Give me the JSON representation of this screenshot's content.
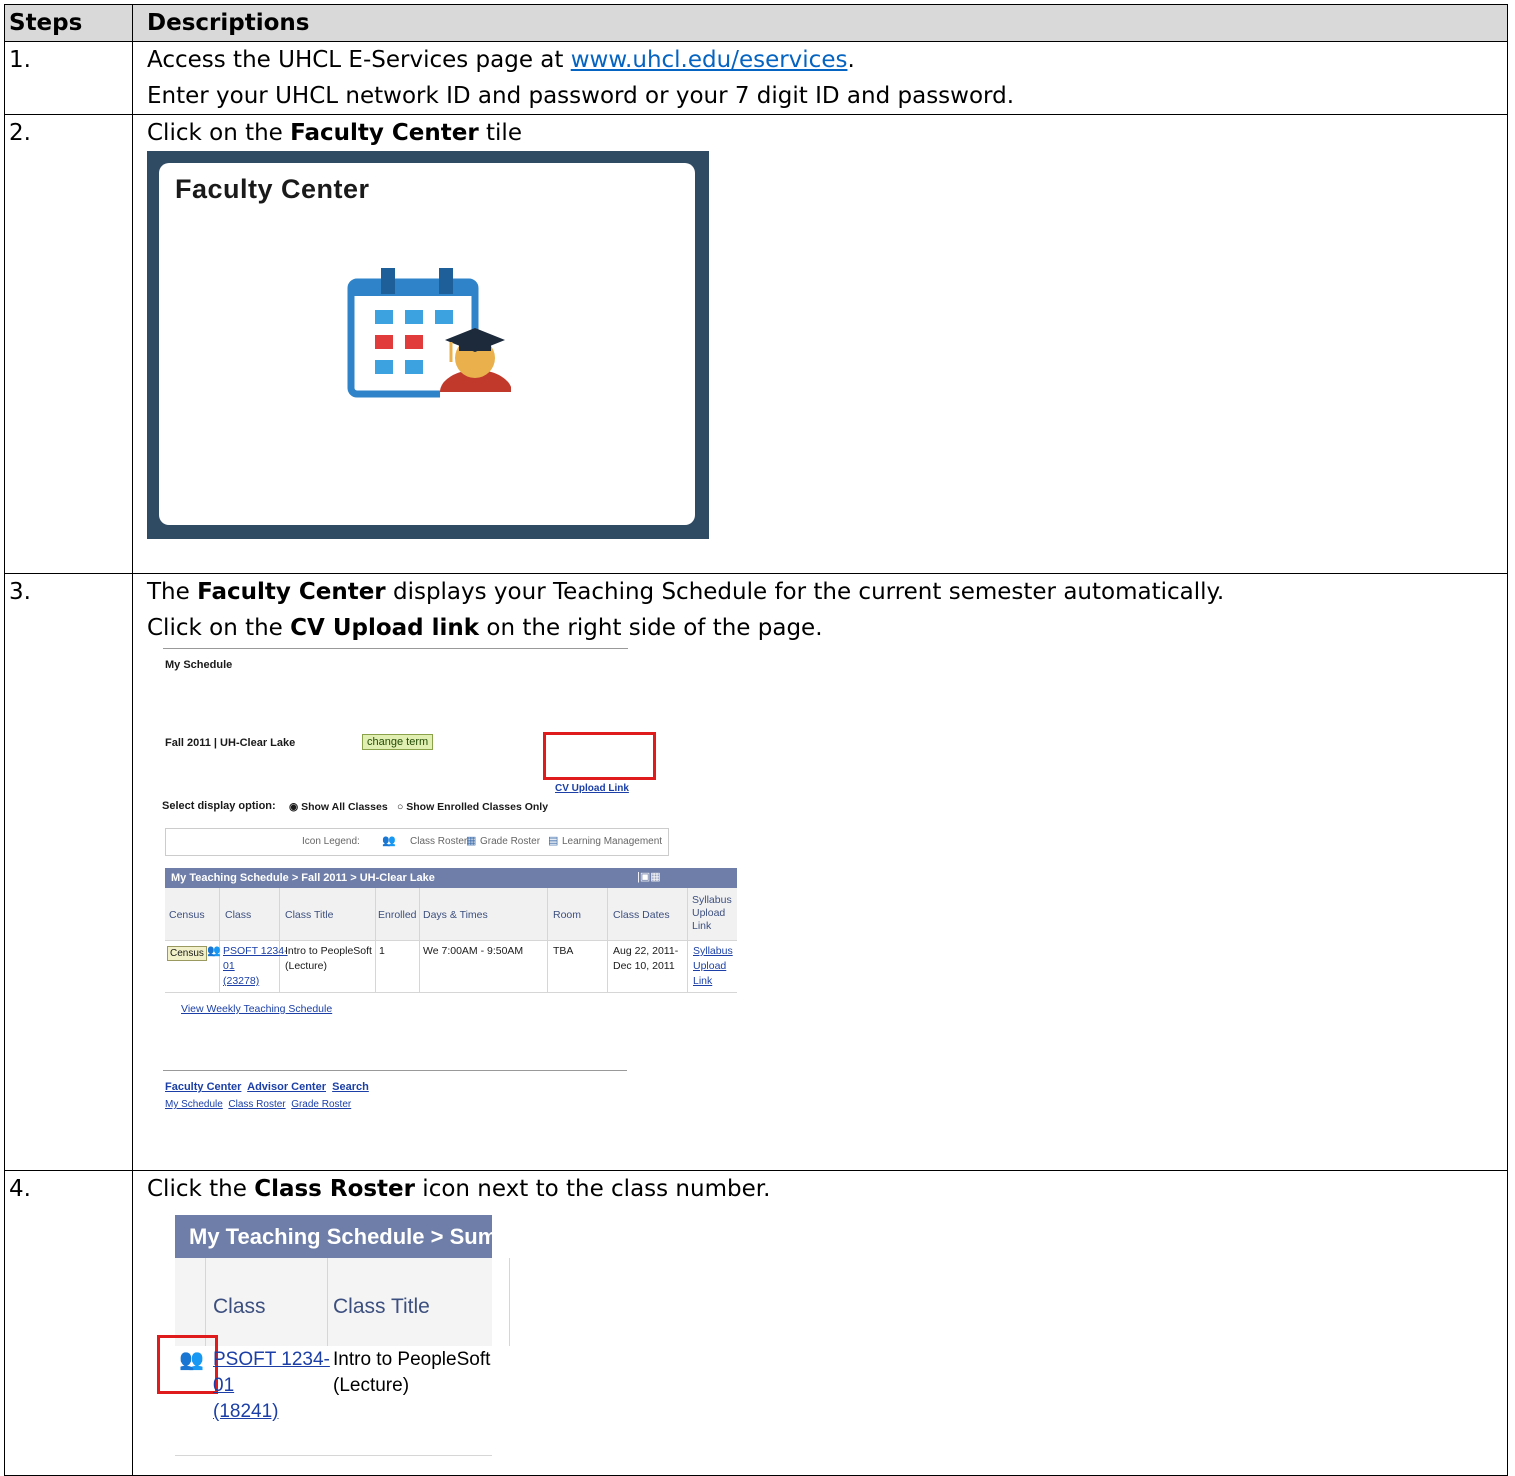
{
  "table": {
    "header_steps": "Steps",
    "header_desc": "Descriptions"
  },
  "step1": {
    "num": "1.",
    "line1_pre": "Access the UHCL E-Services page at ",
    "line1_link": "www.uhcl.edu/eservices",
    "line1_post": ".",
    "line2": "Enter your UHCL network ID and password or your 7 digit ID and password."
  },
  "step2": {
    "num": "2.",
    "pre": "Click on the ",
    "bold": "Faculty Center",
    "post": " tile",
    "tile_title": "Faculty Center"
  },
  "step3": {
    "num": "3.",
    "line1_pre": "The ",
    "line1_bold": "Faculty Center",
    "line1_post": " displays your Teaching Schedule for the current semester automatically.",
    "line2_pre": "Click on the ",
    "line2_bold": "CV Upload link",
    "line2_post": " on the right side of the page.",
    "shot": {
      "my_schedule": "My Schedule",
      "term": "Fall 2011 | UH-Clear Lake",
      "change_term": "change term",
      "cv_upload": "CV Upload Link",
      "select_display": "Select display option:",
      "opt_all": "Show All Classes",
      "opt_enrolled": "Show Enrolled Classes Only",
      "icon_legend": "Icon Legend:",
      "legend_roster": "Class Roster",
      "legend_grade": "Grade Roster",
      "legend_lm": "Learning Management",
      "sched_title": "My Teaching Schedule > Fall 2011 > UH-Clear Lake",
      "cols": [
        "Census",
        "Class",
        "Class Title",
        "Enrolled",
        "Days & Times",
        "Room",
        "Class Dates",
        "Syllabus Upload Link"
      ],
      "row": {
        "census": "Census",
        "class_l1": "PSOFT 1234-",
        "class_l2": "01",
        "class_l3": "(23278)",
        "title_l1": "Intro to PeopleSoft",
        "title_l2": "(Lecture)",
        "enrolled": "1",
        "days": "We 7:00AM - 9:50AM",
        "room": "TBA",
        "dates_l1": "Aug 22, 2011-",
        "dates_l2": "Dec 10, 2011",
        "syl_l1": "Syllabus",
        "syl_l2": "Upload",
        "syl_l3": "Link"
      },
      "weekly": "View Weekly Teaching Schedule",
      "footer_main": [
        "Faculty Center",
        "Advisor Center",
        "Search"
      ],
      "footer_sub": [
        "My Schedule",
        "Class Roster",
        "Grade Roster"
      ]
    }
  },
  "step4": {
    "num": "4.",
    "pre": "Click the ",
    "bold": "Class Roster",
    "post": " icon next to the class number.",
    "shot": {
      "head": "My Teaching Schedule > Sum",
      "col_class": "Class",
      "col_title": "Class Title",
      "class_l1": "PSOFT 1234-",
      "class_l2": "01",
      "class_l3": "(18241)",
      "title_l1": "Intro to PeopleSoft",
      "title_l2": "(Lecture)"
    }
  },
  "colors": {
    "tile_frame": "#2f4a63",
    "header_bg": "#d9d9d9",
    "link": "#0563c1",
    "highlight": "#e01b1b",
    "schedule_header": "#6f7ea8"
  }
}
